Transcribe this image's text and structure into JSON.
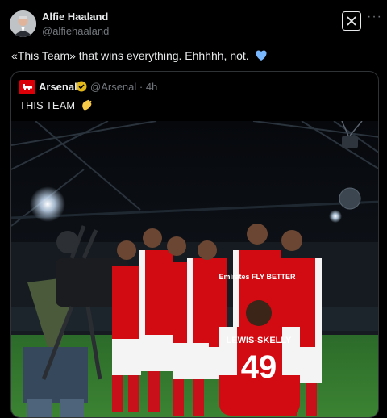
{
  "tweet": {
    "author_name": "Alfie Haaland",
    "author_handle": "@alfiehaaland",
    "text": "«This Team» that wins everything. Ehhhhh, not.",
    "text_emoji": "blue-heart-icon"
  },
  "quoted_tweet": {
    "author_name": "Arsenal",
    "author_handle": "@Arsenal",
    "time": "4h",
    "separator": "·",
    "text": "THIS TEAM",
    "text_emoji": "clapping-hands-icon"
  },
  "photo": {
    "shirt_name": "LEWIS-SKELLY",
    "shirt_number": "49",
    "shirt_sponsor": "Emirates FLY BETTER"
  },
  "colors": {
    "background": "#000000",
    "text_primary": "#e7e9ea",
    "text_secondary": "#71767b",
    "border": "#2f3336",
    "arsenal_red": "#db0007",
    "verified_gold": "#e2b719",
    "heart_blue": "#79b8ff"
  }
}
